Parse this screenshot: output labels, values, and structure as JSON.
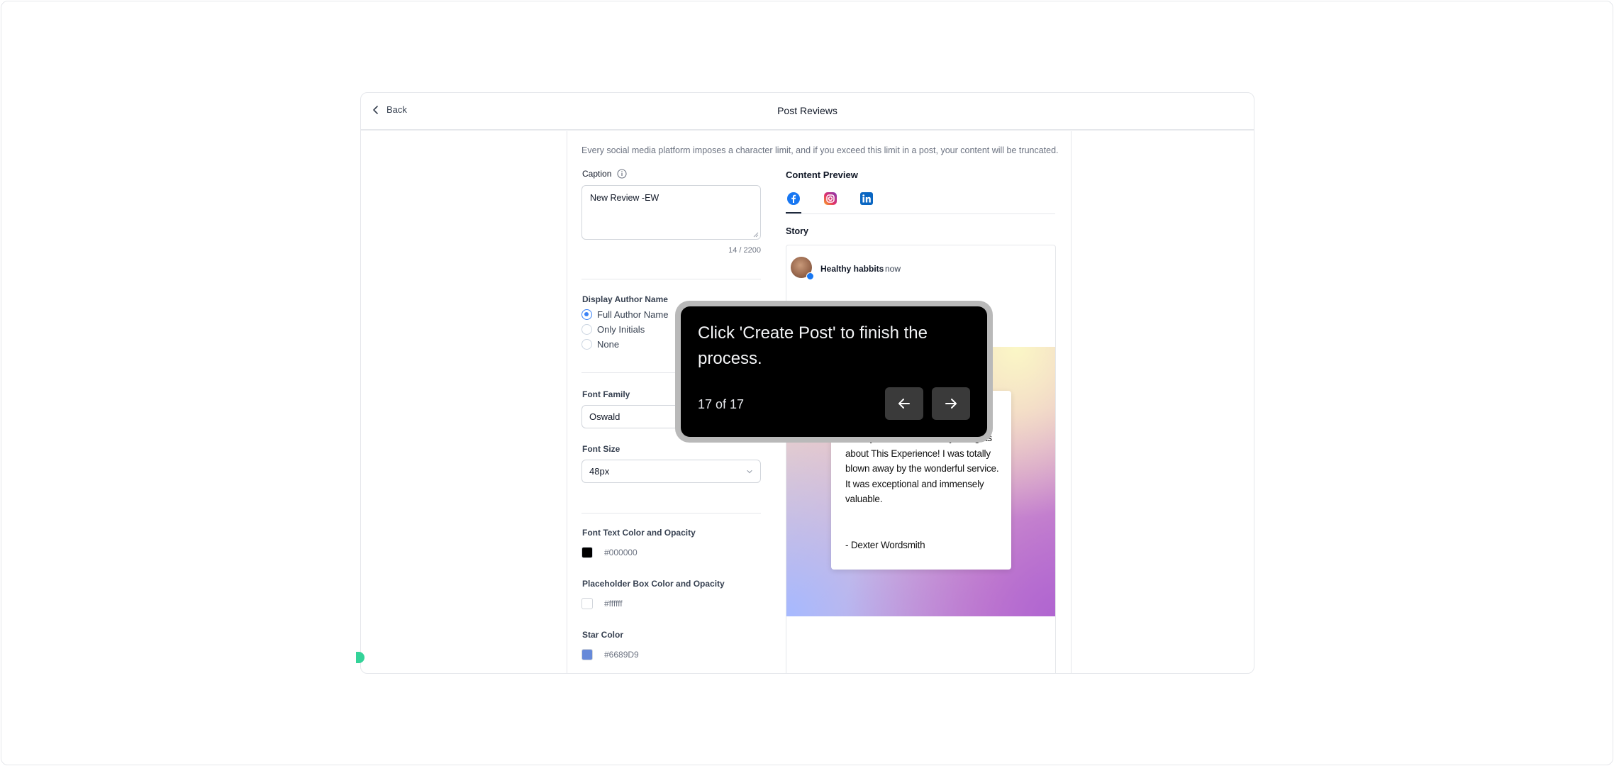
{
  "header": {
    "back_label": "Back",
    "title": "Post Reviews"
  },
  "form": {
    "info_text": "Every social media platform imposes a character limit, and if you exceed this limit in a post, your content will be truncated.",
    "caption": {
      "label": "Caption",
      "value": "New Review -EW",
      "counter": "14 / 2200"
    },
    "author_name": {
      "label": "Display Author Name",
      "options": [
        "Full Author Name",
        "Only Initials",
        "None"
      ],
      "selected": "Full Author Name"
    },
    "font_family": {
      "label": "Font Family",
      "value": "Oswald"
    },
    "font_size": {
      "label": "Font Size",
      "value": "48px"
    },
    "font_color": {
      "label": "Font Text Color and Opacity",
      "value": "#000000",
      "swatch": "#000000"
    },
    "placeholder_color": {
      "label": "Placeholder Box Color and Opacity",
      "value": "#ffffff",
      "swatch": "#ffffff"
    },
    "star_color": {
      "label": "Star Color",
      "value": "#6689D9",
      "swatch": "#6689D9"
    }
  },
  "preview": {
    "title": "Content Preview",
    "tabs": [
      "facebook-icon",
      "instagram-icon",
      "linkedin-icon"
    ],
    "active_tab": "facebook-icon",
    "story_label": "Story",
    "page_name": "Healthy habbits",
    "time": "now",
    "review_text": "Wow, just had to share my thoughts about This Experience! I was totally blown away by the wonderful service. It was exceptional and immensely valuable.",
    "review_author": "- Dexter Wordsmith"
  },
  "tour": {
    "message": "Click 'Create Post' to finish the process.",
    "step": "17 of 17",
    "prev_icon": "arrow-left-icon",
    "next_icon": "arrow-right-icon"
  }
}
